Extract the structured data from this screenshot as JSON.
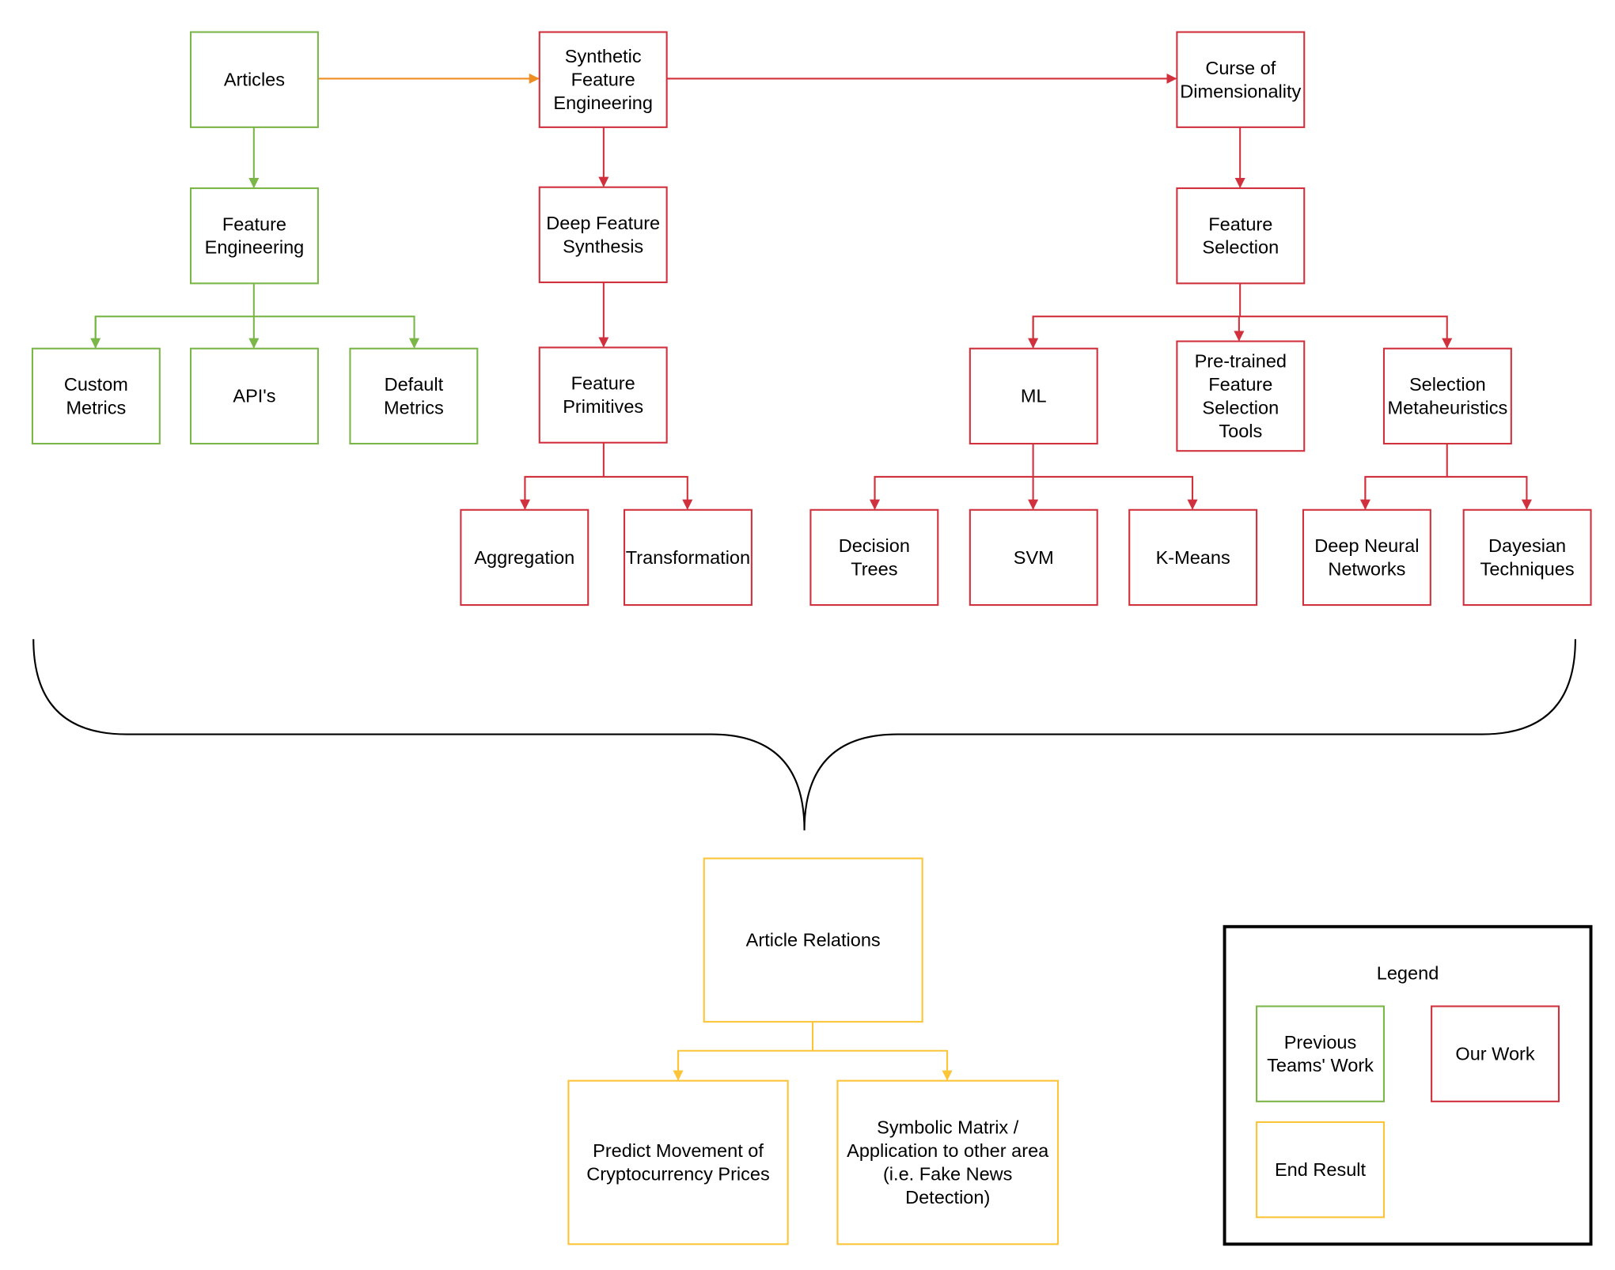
{
  "colors": {
    "green": "#7ab648",
    "red": "#d0313d",
    "orange": "#ef8d22",
    "yellow": "#fcc438",
    "black": "#000000"
  },
  "nodes": [
    {
      "id": "articles",
      "lines": [
        "Articles"
      ],
      "color": "green"
    },
    {
      "id": "synthetic-feature-engineering",
      "lines": [
        "Synthetic",
        "Feature",
        "Engineering"
      ],
      "color": "red"
    },
    {
      "id": "curse-of-dimensionality",
      "lines": [
        "Curse of",
        "Dimensionality"
      ],
      "color": "red"
    },
    {
      "id": "feature-engineering",
      "lines": [
        "Feature",
        "Engineering"
      ],
      "color": "green"
    },
    {
      "id": "deep-feature-synthesis",
      "lines": [
        "Deep Feature",
        "Synthesis"
      ],
      "color": "red"
    },
    {
      "id": "feature-selection",
      "lines": [
        "Feature",
        "Selection"
      ],
      "color": "red"
    },
    {
      "id": "custom-metrics",
      "lines": [
        "Custom",
        "Metrics"
      ],
      "color": "green"
    },
    {
      "id": "apis",
      "lines": [
        "API's"
      ],
      "color": "green"
    },
    {
      "id": "default-metrics",
      "lines": [
        "Default",
        "Metrics"
      ],
      "color": "green"
    },
    {
      "id": "feature-primitives",
      "lines": [
        "Feature",
        "Primitives"
      ],
      "color": "red"
    },
    {
      "id": "ml",
      "lines": [
        "ML"
      ],
      "color": "red"
    },
    {
      "id": "pretrained-tools",
      "lines": [
        "Pre-trained",
        "Feature",
        "Selection",
        "Tools"
      ],
      "color": "red"
    },
    {
      "id": "selection-metaheuristics",
      "lines": [
        "Selection",
        "Metaheuristics"
      ],
      "color": "red"
    },
    {
      "id": "aggregation",
      "lines": [
        "Aggregation"
      ],
      "color": "red"
    },
    {
      "id": "transformation",
      "lines": [
        "Transformation"
      ],
      "color": "red"
    },
    {
      "id": "decision-trees",
      "lines": [
        "Decision",
        "Trees"
      ],
      "color": "red"
    },
    {
      "id": "svm",
      "lines": [
        "SVM"
      ],
      "color": "red"
    },
    {
      "id": "k-means",
      "lines": [
        "K-Means"
      ],
      "color": "red"
    },
    {
      "id": "deep-neural-networks",
      "lines": [
        "Deep Neural",
        "Networks"
      ],
      "color": "red"
    },
    {
      "id": "dayesian-techniques",
      "lines": [
        "Dayesian",
        "Techniques"
      ],
      "color": "red"
    },
    {
      "id": "article-relations",
      "lines": [
        "Article Relations"
      ],
      "color": "yellow"
    },
    {
      "id": "predict-movement",
      "lines": [
        "Predict Movement of",
        "Cryptocurrency Prices"
      ],
      "color": "yellow"
    },
    {
      "id": "symbolic-matrix",
      "lines": [
        "Symbolic Matrix /",
        "Application to other area",
        "(i.e. Fake News",
        "Detection)"
      ],
      "color": "yellow"
    }
  ],
  "legend": {
    "title": "Legend",
    "items": [
      {
        "lines": [
          "Previous",
          "Teams' Work"
        ],
        "color": "green"
      },
      {
        "lines": [
          "Our Work"
        ],
        "color": "red"
      },
      {
        "lines": [
          "End Result"
        ],
        "color": "yellow"
      }
    ]
  }
}
